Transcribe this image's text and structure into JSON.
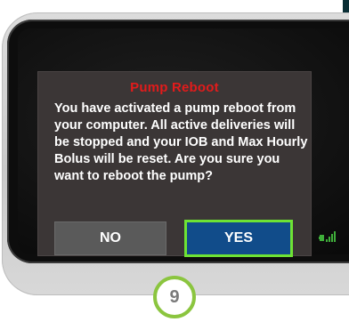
{
  "dialog": {
    "title": "Pump Reboot",
    "message": "You have activated a pump reboot from your computer. All active deliveries will be stopped and your IOB and Max Hourly Bolus will be reset. Are you sure you want to reboot the pump?",
    "no_label": "NO",
    "yes_label": "YES"
  },
  "step_badge": {
    "number": "9"
  },
  "colors": {
    "title": "#e21b1b",
    "dialog_bg": "#3b3636",
    "yes_button": "#114c8a",
    "yes_outline": "#6ee334",
    "no_button": "#5a5a5a",
    "badge_ring": "#8bc53f",
    "status_icon": "#3fae3a"
  },
  "icons": {
    "status": "battery-signal-icon"
  }
}
